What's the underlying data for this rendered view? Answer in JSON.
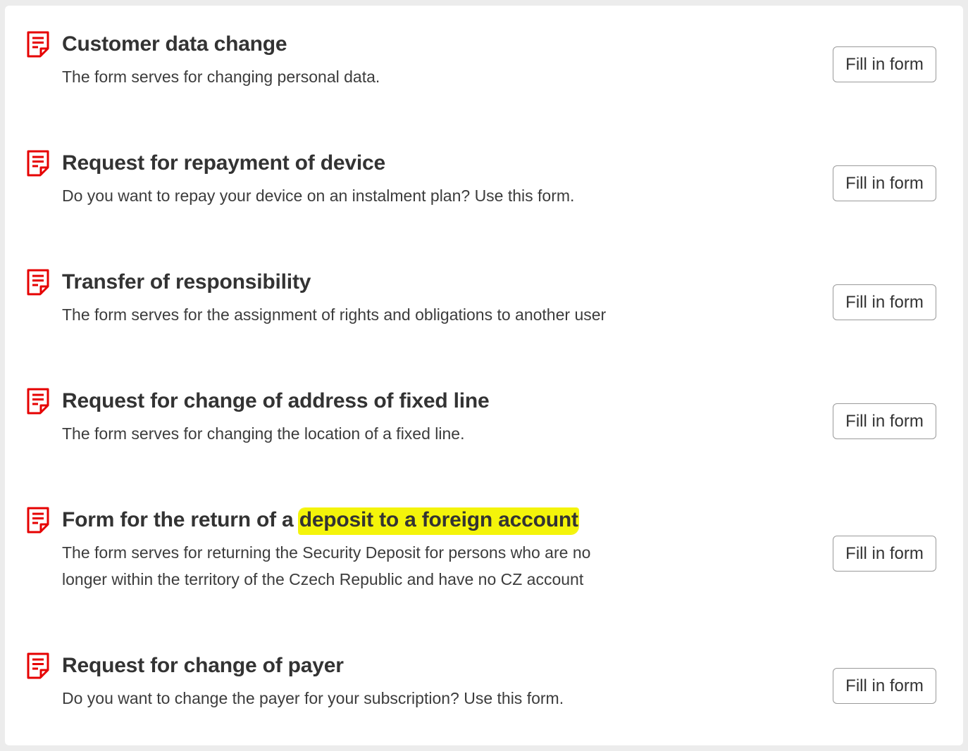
{
  "accent_color": "#e60000",
  "highlight_color": "#f4f40a",
  "icon": "document-form-icon",
  "forms": [
    {
      "title": "Customer data change",
      "description": "The form serves for changing personal data.",
      "button_label": "Fill in form"
    },
    {
      "title": "Request for repayment of device",
      "description": "Do you want to repay your device on an instalment plan? Use this form.",
      "button_label": "Fill in form"
    },
    {
      "title": "Transfer of responsibility",
      "description": "The form serves for the assignment of rights and obligations to another user",
      "button_label": "Fill in form"
    },
    {
      "title": "Request for change of address of fixed line",
      "description": "The form serves for changing the location of a fixed line.",
      "button_label": "Fill in form"
    },
    {
      "title": "Form for the return of a ",
      "title_highlighted": "deposit to a foreign account",
      "description": "The form serves for returning the Security Deposit for persons who are no longer within the territory of the Czech Republic and have no CZ account",
      "button_label": "Fill in form"
    },
    {
      "title": "Request for change of payer",
      "description": "Do you want to change the payer for your subscription? Use this form.",
      "button_label": "Fill in form"
    }
  ]
}
